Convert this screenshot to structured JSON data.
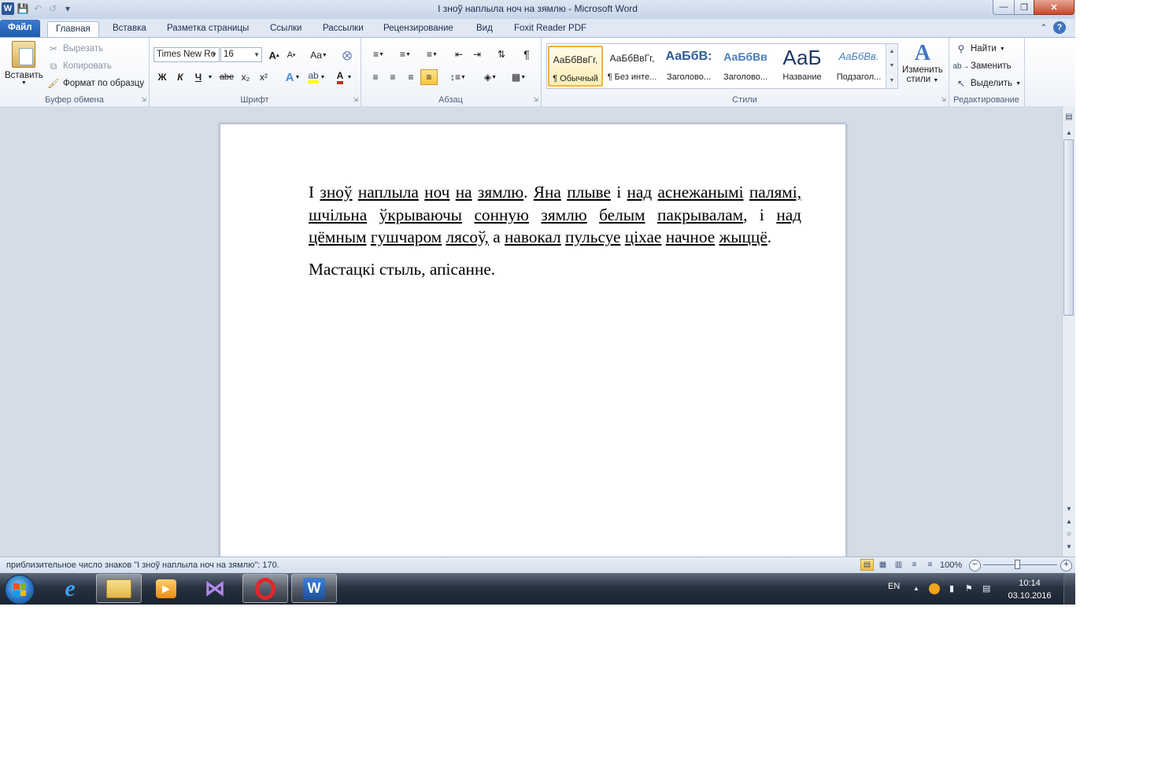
{
  "window": {
    "title": "І зноў наплыла ноч на зямлю  -  Microsoft Word",
    "app_letter": "W"
  },
  "tabs": [
    "Файл",
    "Главная",
    "Вставка",
    "Разметка страницы",
    "Ссылки",
    "Рассылки",
    "Рецензирование",
    "Вид",
    "Foxit Reader PDF"
  ],
  "ribbon": {
    "clipboard": {
      "paste": "Вставить",
      "cut": "Вырезать",
      "copy": "Копировать",
      "format_painter": "Формат по образцу",
      "label": "Буфер обмена"
    },
    "font": {
      "name": "Times New Rc",
      "size": "16",
      "label": "Шрифт",
      "bold": "Ж",
      "italic": "К",
      "underline": "Ч",
      "strike": "abe",
      "subscript": "x₂",
      "superscript": "x²",
      "grow": "A",
      "shrink": "A",
      "case": "Aa"
    },
    "paragraph": {
      "label": "Абзац"
    },
    "styles": {
      "label": "Стили",
      "items": [
        {
          "sample": "АаБбВвГг,",
          "name": "¶ Обычный",
          "selected": true
        },
        {
          "sample": "АаБбВвГг,",
          "name": "¶ Без инте...",
          "selected": false
        },
        {
          "sample": "АаБбВ:",
          "name": "Заголово...",
          "selected": false
        },
        {
          "sample": "АаБбВв",
          "name": "Заголово...",
          "selected": false
        },
        {
          "sample": "АаБ",
          "name": "Название",
          "selected": false
        },
        {
          "sample": "АаБбВв.",
          "name": "Подзагол...",
          "selected": false
        }
      ],
      "change_styles_1": "Изменить",
      "change_styles_2": "стили"
    },
    "editing": {
      "label": "Редактирование",
      "find": "Найти",
      "replace": "Заменить",
      "select": "Выделить"
    }
  },
  "document": {
    "para1": [
      {
        "t": "І ",
        "u": false
      },
      {
        "t": "зноў",
        "u": true
      },
      {
        "t": " ",
        "u": false
      },
      {
        "t": "наплыла",
        "u": true
      },
      {
        "t": " ",
        "u": false
      },
      {
        "t": "ноч",
        "u": true
      },
      {
        "t": " ",
        "u": false
      },
      {
        "t": "на",
        "u": true
      },
      {
        "t": " ",
        "u": false
      },
      {
        "t": "зямлю",
        "u": true
      },
      {
        "t": ". ",
        "u": false
      },
      {
        "t": "Яна",
        "u": true
      },
      {
        "t": " ",
        "u": false
      },
      {
        "t": "плыве",
        "u": true
      },
      {
        "t": " і ",
        "u": false
      },
      {
        "t": "над",
        "u": true
      },
      {
        "t": " ",
        "u": false
      },
      {
        "t": "аснежанымі",
        "u": true
      },
      {
        "t": " ",
        "u": false
      },
      {
        "t": "палямі,",
        "u": true
      },
      {
        "t": " ",
        "u": false
      },
      {
        "t": "шчільна",
        "u": true
      },
      {
        "t": " ",
        "u": false
      },
      {
        "t": "ўкрываючы",
        "u": true
      },
      {
        "t": " ",
        "u": false
      },
      {
        "t": "сонную",
        "u": true
      },
      {
        "t": " ",
        "u": false
      },
      {
        "t": "зямлю",
        "u": true
      },
      {
        "t": " ",
        "u": false
      },
      {
        "t": "белым",
        "u": true
      },
      {
        "t": " ",
        "u": false
      },
      {
        "t": "пакрывалам",
        "u": true
      },
      {
        "t": ", і ",
        "u": false
      },
      {
        "t": "над",
        "u": true
      },
      {
        "t": " ",
        "u": false
      },
      {
        "t": "цёмным",
        "u": true
      },
      {
        "t": " ",
        "u": false
      },
      {
        "t": "гушчаром",
        "u": true
      },
      {
        "t": " ",
        "u": false
      },
      {
        "t": "лясоў,",
        "u": true
      },
      {
        "t": " а ",
        "u": false
      },
      {
        "t": "навокал",
        "u": true
      },
      {
        "t": " ",
        "u": false
      },
      {
        "t": "пульсуе",
        "u": true
      },
      {
        "t": " ",
        "u": false
      },
      {
        "t": "ціхае",
        "u": true
      },
      {
        "t": " ",
        "u": false
      },
      {
        "t": "начное",
        "u": true
      },
      {
        "t": " ",
        "u": false
      },
      {
        "t": "жыццё",
        "u": true
      },
      {
        "t": ".",
        "u": false
      }
    ],
    "para2": "Мастацкі  стыль, апісанне."
  },
  "statusbar": {
    "text": "приблизительное число знаков \"І зноў наплыла ноч на зямлю\": 170.",
    "zoom": "100%",
    "zoom_fraction": 0.46
  },
  "taskbar": {
    "lang": "EN",
    "time": "10:14",
    "date": "03.10.2016"
  },
  "colors": {
    "accent": "#2b5797",
    "file_tab": "#1f5cad",
    "selection_highlight": "#f7c43c"
  }
}
